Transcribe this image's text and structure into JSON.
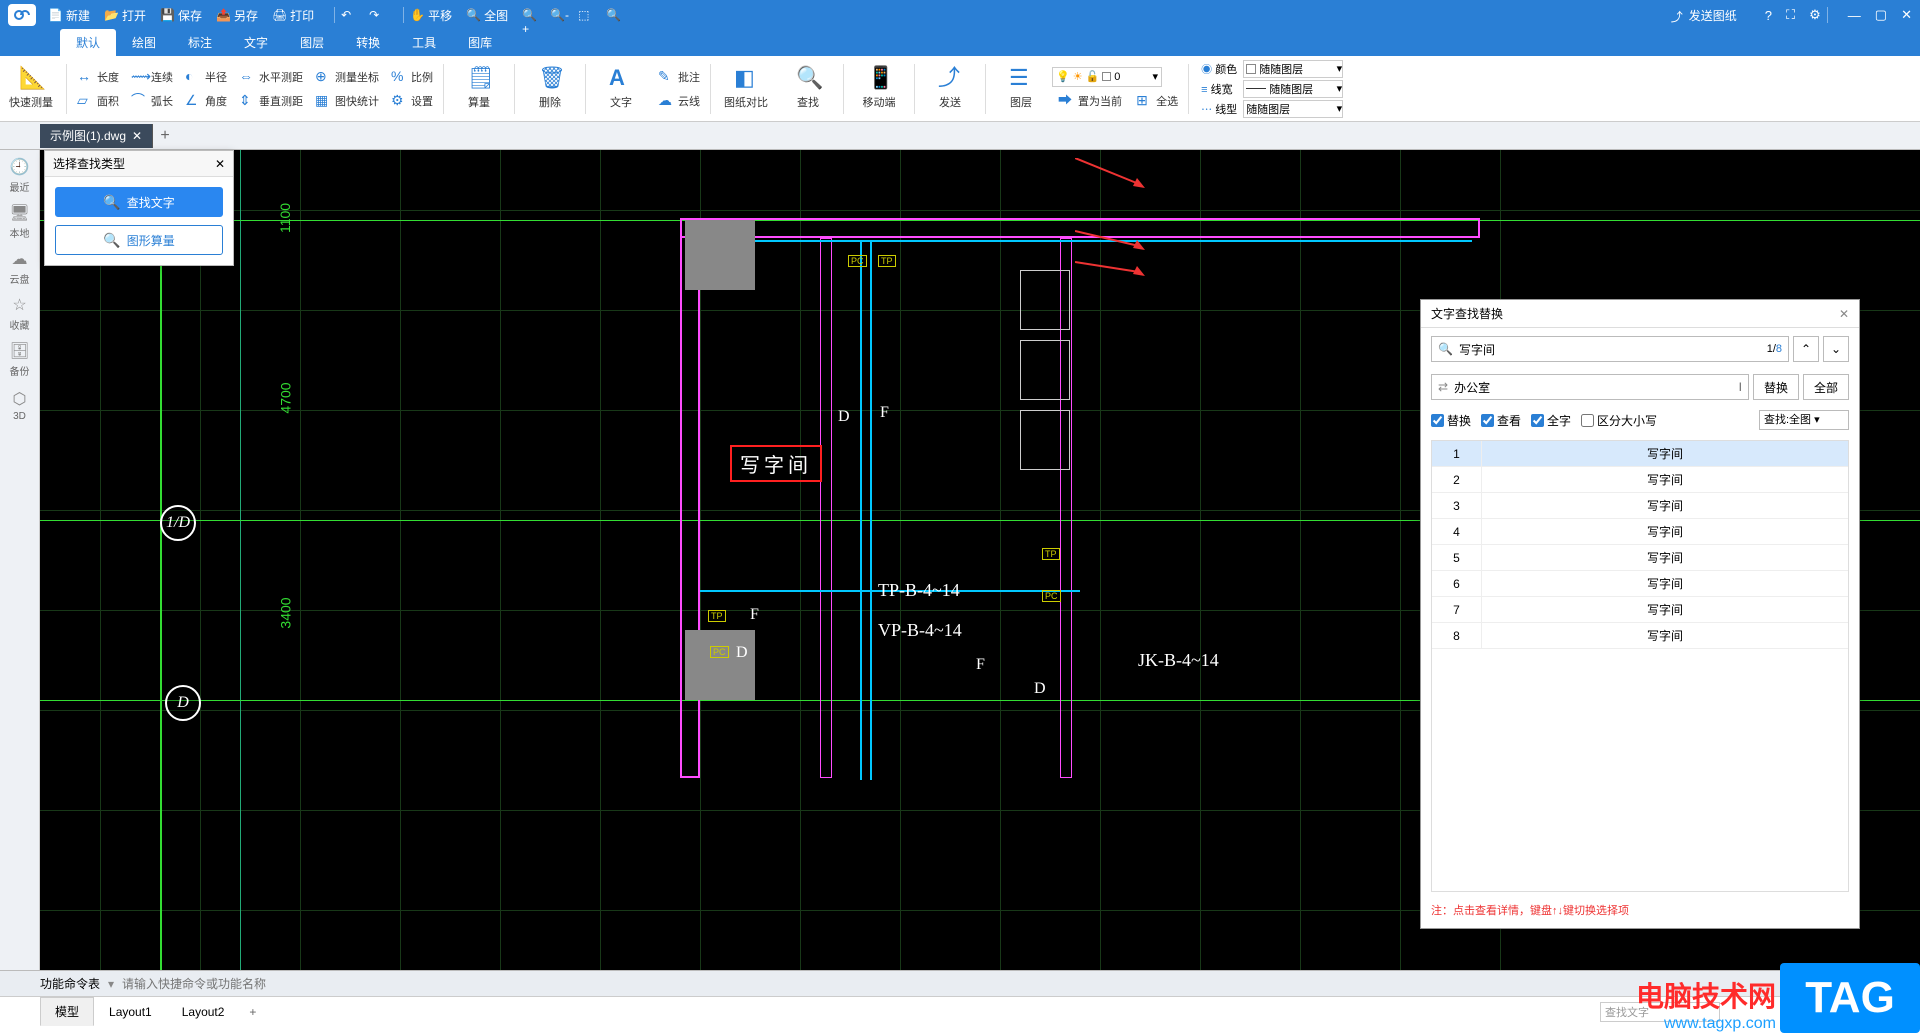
{
  "titlebar": {
    "quick": {
      "new": "新建",
      "open": "打开",
      "save": "保存",
      "saveas": "另存",
      "print": "打印",
      "pan": "平移",
      "zoomall": "全图"
    },
    "send": "发送图纸"
  },
  "menu": {
    "default": "默认",
    "draw": "绘图",
    "annotate": "标注",
    "text": "文字",
    "layer": "图层",
    "convert": "转换",
    "tool": "工具",
    "library": "图库"
  },
  "ribbon": {
    "quick_measure": "快速测量",
    "length": "长度",
    "area": "面积",
    "continuous": "连续",
    "arc": "弧长",
    "radius": "半径",
    "angle": "角度",
    "hdist": "水平测距",
    "vdist": "垂直测距",
    "coord": "测量坐标",
    "stats": "图快统计",
    "scale": "比例",
    "settings": "设置",
    "calc": "算量",
    "delete": "删除",
    "text": "文字",
    "annotate": "批注",
    "cloud": "云线",
    "compare": "图纸对比",
    "find": "查找",
    "mobile": "移动端",
    "send": "发送",
    "layer": "图层",
    "setcurrent": "置为当前",
    "selectall": "全选",
    "layer_value": "0",
    "color_lbl": "颜色",
    "color_val": "随随图层",
    "lw_lbl": "线宽",
    "lw_val": "随随图层",
    "lt_lbl": "线型",
    "lt_val": "随随图层"
  },
  "doc": {
    "tab": "示例图(1).dwg"
  },
  "sidebar": {
    "recent": "最近",
    "local": "本地",
    "cloud": "云盘",
    "fav": "收藏",
    "backup": "备份",
    "threed": "3D"
  },
  "findtype": {
    "title": "选择查找类型",
    "text": "查找文字",
    "shape": "图形算量"
  },
  "canvas": {
    "dim1": "1100",
    "dim2": "4700",
    "dim3": "3400",
    "room": "写字间",
    "c1": "1/D",
    "c2": "D",
    "t1": "D",
    "t2": "F",
    "t3": "F",
    "t4": "D",
    "t5": "F",
    "t6": "D",
    "tp1": "TP-B-4~14",
    "tp2": "VP-B-4~14",
    "tp3": "JK-B-4~14",
    "pc": "PC",
    "tp": "TP"
  },
  "findpanel": {
    "title": "文字查找替换",
    "search_value": "写字间",
    "replace_value": "办公室",
    "count_cur": "1",
    "count_total": "8",
    "btn_replace": "替换",
    "btn_all": "全部",
    "opt_replace": "替换",
    "opt_view": "查看",
    "opt_whole": "全字",
    "opt_case": "区分大小写",
    "scope": "查找:全图",
    "results": [
      {
        "n": "1",
        "t": "写字间"
      },
      {
        "n": "2",
        "t": "写字间"
      },
      {
        "n": "3",
        "t": "写字间"
      },
      {
        "n": "4",
        "t": "写字间"
      },
      {
        "n": "5",
        "t": "写字间"
      },
      {
        "n": "6",
        "t": "写字间"
      },
      {
        "n": "7",
        "t": "写字间"
      },
      {
        "n": "8",
        "t": "写字间"
      }
    ],
    "note": "注：点击查看详情，键盘↑↓键切换选择项"
  },
  "cmdbar": {
    "label": "功能命令表",
    "placeholder": "请输入快捷命令或功能名称"
  },
  "layouts": {
    "model": "模型",
    "l1": "Layout1",
    "l2": "Layout2",
    "search_ph": "查找文字"
  },
  "watermark": {
    "line1": "电脑技术网",
    "line2": "www.tagxp.com",
    "tag": "TAG"
  }
}
